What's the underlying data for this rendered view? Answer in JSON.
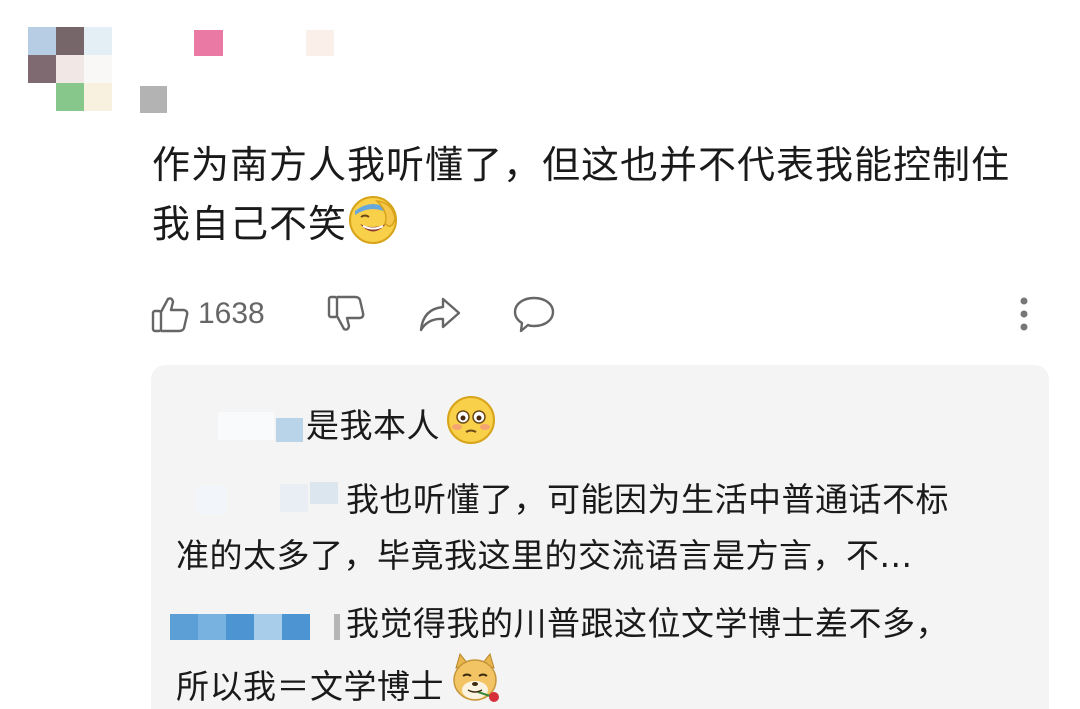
{
  "comment": {
    "line1": "作为南方人我听懂了，但这也并不代表我能控制住",
    "line2": "我自己不笑",
    "emoji": "facepalm-laugh-emoji"
  },
  "actions": {
    "like_count": "1638",
    "icons": [
      "thumbs-up-icon",
      "thumbs-down-icon",
      "share-icon",
      "comment-bubble-icon",
      "more-vertical-icon"
    ]
  },
  "replies": [
    {
      "text": "是我本人",
      "emoji": "flushed-face-emoji"
    },
    {
      "line1": "我也听懂了，可能因为生活中普通话不标",
      "line2": "准的太多了，毕竟我这里的交流语言是方言，不..."
    },
    {
      "line1": "我觉得我的川普跟这位文学博士差不多，",
      "line2": "所以我＝文学博士",
      "emoji": "doge-rose-emoji"
    }
  ],
  "colors": {
    "background": "#ffffff",
    "reply_bg": "#f4f4f4",
    "icon": "#666666",
    "text": "#1a1a1a"
  }
}
